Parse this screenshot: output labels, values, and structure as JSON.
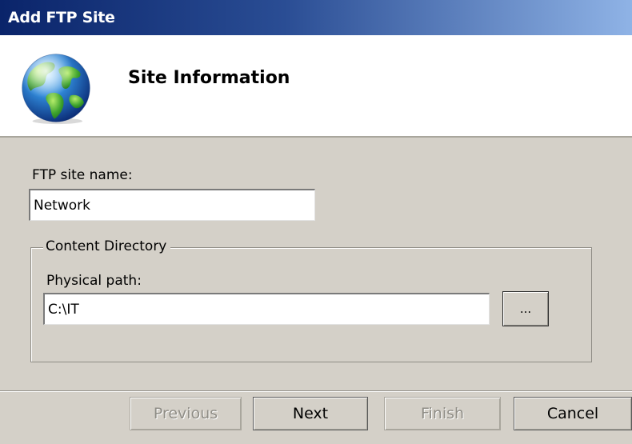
{
  "window": {
    "title": "Add FTP Site"
  },
  "header": {
    "icon": "globe-icon",
    "title": "Site Information"
  },
  "form": {
    "site_name_label": "FTP site name:",
    "site_name_value": "Network",
    "content_directory_label": "Content Directory",
    "physical_path_label": "Physical path:",
    "physical_path_value": "C:\\IT",
    "browse_label": "..."
  },
  "footer": {
    "previous_label": "Previous",
    "next_label": "Next",
    "finish_label": "Finish",
    "cancel_label": "Cancel"
  },
  "colors": {
    "title_gradient_start": "#0a246a",
    "title_gradient_end": "#8fb3e6",
    "dialog_background": "#d4d0c8",
    "header_background": "#ffffff"
  }
}
